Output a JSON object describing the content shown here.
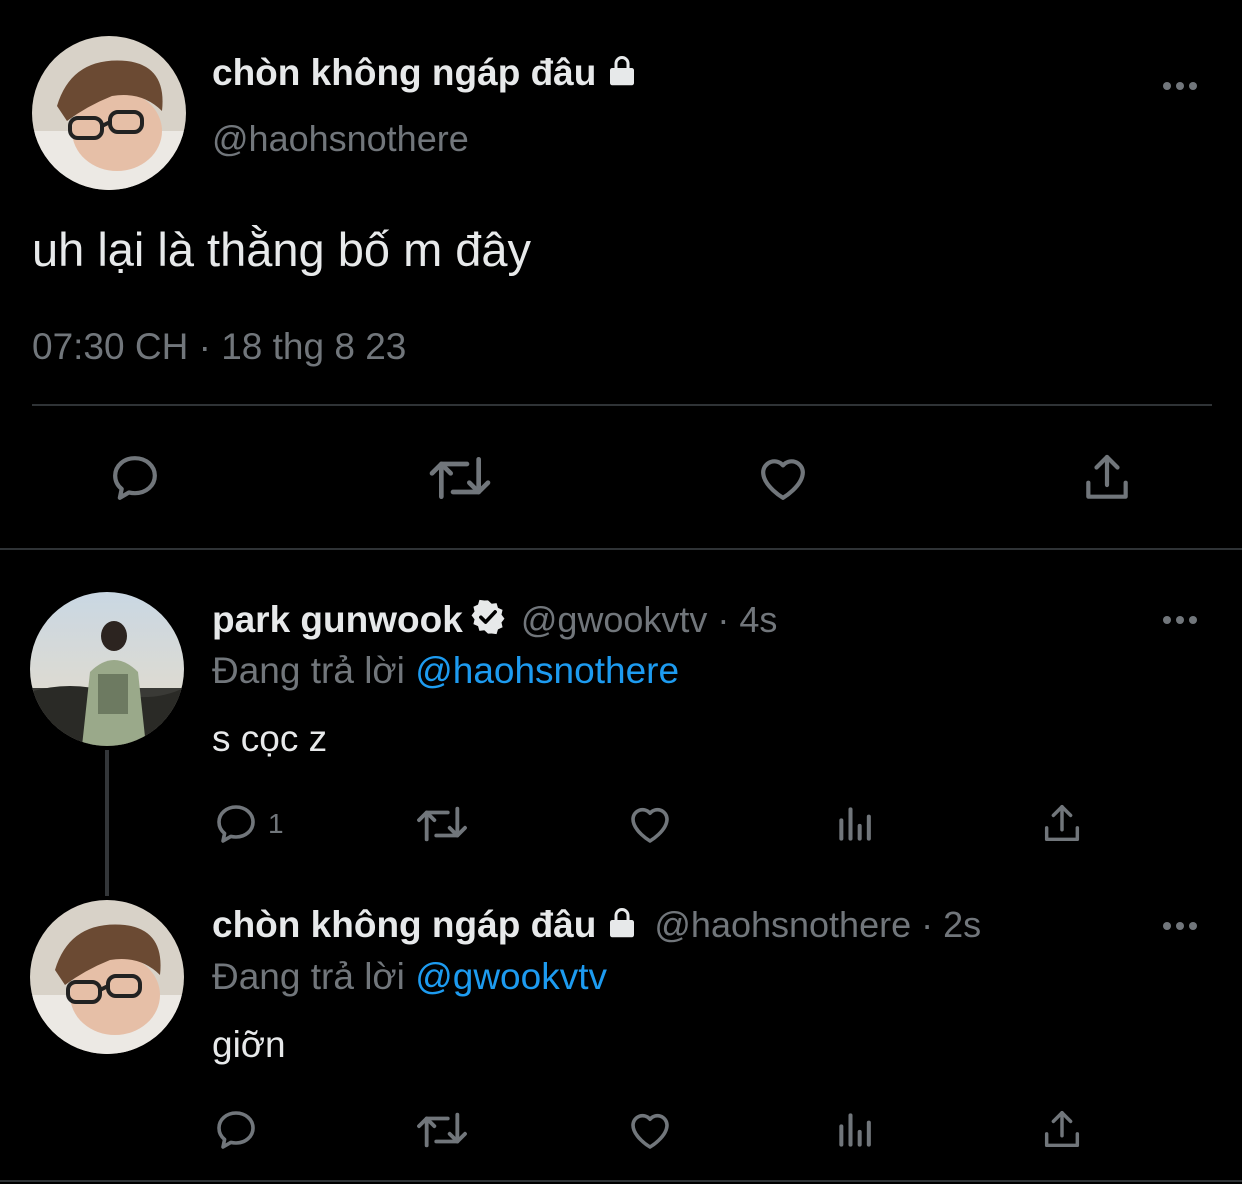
{
  "main_tweet": {
    "display_name": "chòn không ngáp đâu",
    "handle": "@haohsnothere",
    "text": "uh lại là thằng bố m đây",
    "timestamp": "07:30 CH · 18 thg 8 23",
    "icons": {
      "more": "more-icon",
      "lock": "lock-icon"
    }
  },
  "main_actions": [
    "reply-icon",
    "retweet-icon",
    "like-icon",
    "share-icon"
  ],
  "replies": [
    {
      "display_name": "park gunwook",
      "handle_time": "@gwookvtv · 4s",
      "replying_prefix": "Đang trả lời",
      "replying_to": "@haohsnothere",
      "text": "s cọc z",
      "reply_count": "1",
      "verified": true
    },
    {
      "display_name": "chòn không ngáp đâu",
      "handle_time": "@haohsnothere · 2s",
      "replying_prefix": "Đang trả lời",
      "replying_to": "@gwookvtv",
      "text": "giỡn",
      "reply_count": "",
      "verified": false
    }
  ],
  "colors": {
    "background": "#000000",
    "text": "#e7e9ea",
    "muted": "#71767b",
    "link": "#1d9bf0",
    "divider": "#2f3336"
  }
}
